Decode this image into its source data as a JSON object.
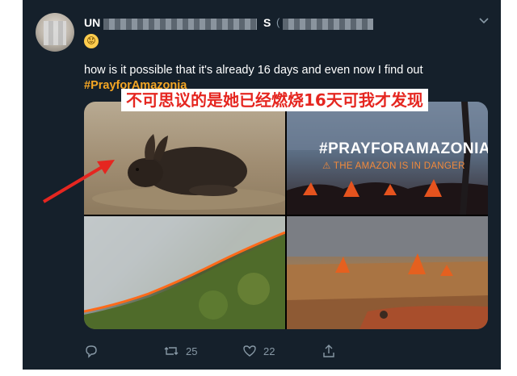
{
  "tweet": {
    "display_name_visible": "UN",
    "display_name_tail": "S",
    "handle_visible": "(",
    "emoji": "😟",
    "text": "how is it possible that it's already 16 days and even now I find out",
    "hashtag": "#PrayforAmazonia",
    "overlay_caption": "不可思议的是她已经燃烧16天可我才发现",
    "media": {
      "poster_title": "#PRAYFORAMAZONIA",
      "poster_subtitle": "THE AMAZON IS IN DANGER"
    },
    "actions": {
      "retweets": "25",
      "likes": "22"
    }
  },
  "colors": {
    "background": "#15202b",
    "hashtag": "#f5a623",
    "overlay_text": "#e52620",
    "arrow": "#e52620",
    "muted": "#8899a6"
  }
}
